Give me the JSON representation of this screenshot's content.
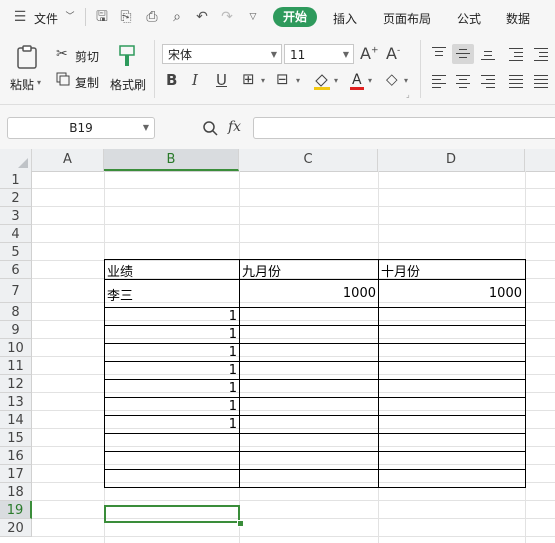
{
  "menu": {
    "file_label": "文件",
    "tabs": [
      "开始",
      "插入",
      "页面布局",
      "公式",
      "数据"
    ]
  },
  "ribbon": {
    "paste_label": "粘贴",
    "cut_label": "剪切",
    "copy_label": "复制",
    "format_painter_label": "格式刷",
    "font_name": "宋体",
    "font_size": "11"
  },
  "formula_bar": {
    "name_box": "B19",
    "fx_label": "fx",
    "formula": ""
  },
  "sheet": {
    "columns": [
      "A",
      "B",
      "C",
      "D"
    ],
    "rows": [
      "1",
      "2",
      "3",
      "4",
      "5",
      "6",
      "7",
      "8",
      "9",
      "10",
      "11",
      "12",
      "13",
      "14",
      "15",
      "16",
      "17",
      "18",
      "19",
      "20"
    ],
    "cells": {
      "B6": "业绩",
      "C6": "九月份",
      "D6": "十月份",
      "B7": "李三",
      "C7": "1000",
      "D7": "1000",
      "B8": "1",
      "B9": "1",
      "B10": "1",
      "B11": "1",
      "B12": "1",
      "B13": "1",
      "B14": "1"
    },
    "selected_cell": "B19"
  },
  "colors": {
    "accent": "#2e9a5c",
    "selection": "#3a8d3a"
  }
}
